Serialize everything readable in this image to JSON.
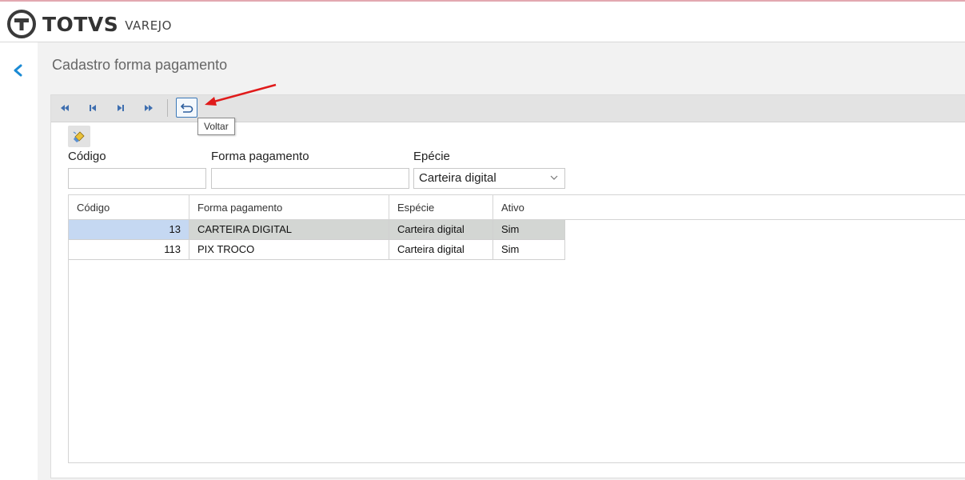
{
  "brand": {
    "name": "TOTVS",
    "product": "VAREJO"
  },
  "page": {
    "title": "Cadastro forma pagamento"
  },
  "toolbar": {
    "nav_icons": [
      "first-record-icon",
      "previous-record-icon",
      "next-record-icon",
      "last-record-icon"
    ],
    "back_icon": "undo-arrow-icon",
    "tooltip": "Voltar"
  },
  "filters": {
    "clear_icon": "brush-icon",
    "codigo": {
      "label": "Código",
      "value": ""
    },
    "forma": {
      "label": "Forma pagamento",
      "value": ""
    },
    "especie": {
      "label": "Epécie",
      "value": "Carteira digital"
    }
  },
  "table": {
    "columns": [
      "Código",
      "Forma pagamento",
      "Espécie",
      "Ativo"
    ],
    "rows": [
      {
        "codigo": "13",
        "forma": "CARTEIRA DIGITAL",
        "especie": "Carteira digital",
        "ativo": "Sim",
        "selected": true
      },
      {
        "codigo": "113",
        "forma": "PIX TROCO",
        "especie": "Carteira digital",
        "ativo": "Sim",
        "selected": false
      }
    ]
  },
  "colors": {
    "accent": "#1a8ad4",
    "toolbar_bg": "#e3e3e3",
    "selected_row": "#d3d6d3",
    "selected_cell": "#c5d8f2",
    "annotation_arrow": "#e01b1b"
  }
}
